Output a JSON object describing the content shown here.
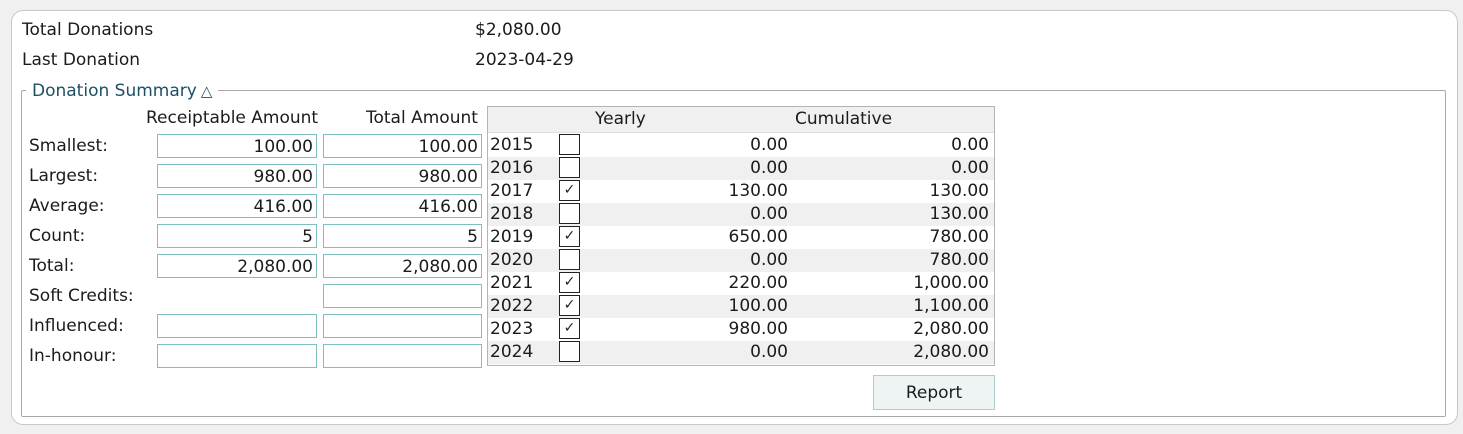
{
  "header": {
    "total_donations_label": "Total Donations",
    "total_donations_value": "$2,080.00",
    "last_donation_label": "Last Donation",
    "last_donation_value": "2023-04-29"
  },
  "summary": {
    "title": "Donation Summary",
    "toggle_glyph": "△",
    "col_receiptable": "Receiptable Amount",
    "col_total": "Total Amount",
    "rows": [
      {
        "label": "Smallest:",
        "receiptable": "100.00",
        "total": "100.00"
      },
      {
        "label": "Largest:",
        "receiptable": "980.00",
        "total": "980.00"
      },
      {
        "label": "Average:",
        "receiptable": "416.00",
        "total": "416.00"
      },
      {
        "label": "Count:",
        "receiptable": "5",
        "total": "5"
      },
      {
        "label": "Total:",
        "receiptable": "2,080.00",
        "total": "2,080.00"
      },
      {
        "label": "Soft Credits:",
        "receiptable": "",
        "total": ""
      },
      {
        "label": "Influenced:",
        "receiptable": "",
        "total": ""
      },
      {
        "label": "In-honour:",
        "receiptable": "",
        "total": ""
      }
    ]
  },
  "yearly": {
    "col_yearly": "Yearly",
    "col_cumulative": "Cumulative",
    "rows": [
      {
        "year": "2015",
        "checked": false,
        "yearly": "0.00",
        "cumulative": "0.00"
      },
      {
        "year": "2016",
        "checked": false,
        "yearly": "0.00",
        "cumulative": "0.00"
      },
      {
        "year": "2017",
        "checked": true,
        "yearly": "130.00",
        "cumulative": "130.00"
      },
      {
        "year": "2018",
        "checked": false,
        "yearly": "0.00",
        "cumulative": "130.00"
      },
      {
        "year": "2019",
        "checked": true,
        "yearly": "650.00",
        "cumulative": "780.00"
      },
      {
        "year": "2020",
        "checked": false,
        "yearly": "0.00",
        "cumulative": "780.00"
      },
      {
        "year": "2021",
        "checked": true,
        "yearly": "220.00",
        "cumulative": "1,000.00"
      },
      {
        "year": "2022",
        "checked": true,
        "yearly": "100.00",
        "cumulative": "1,100.00"
      },
      {
        "year": "2023",
        "checked": true,
        "yearly": "980.00",
        "cumulative": "2,080.00"
      },
      {
        "year": "2024",
        "checked": false,
        "yearly": "0.00",
        "cumulative": "2,080.00"
      }
    ]
  },
  "report_button_label": "Report",
  "check_glyph": "✓"
}
